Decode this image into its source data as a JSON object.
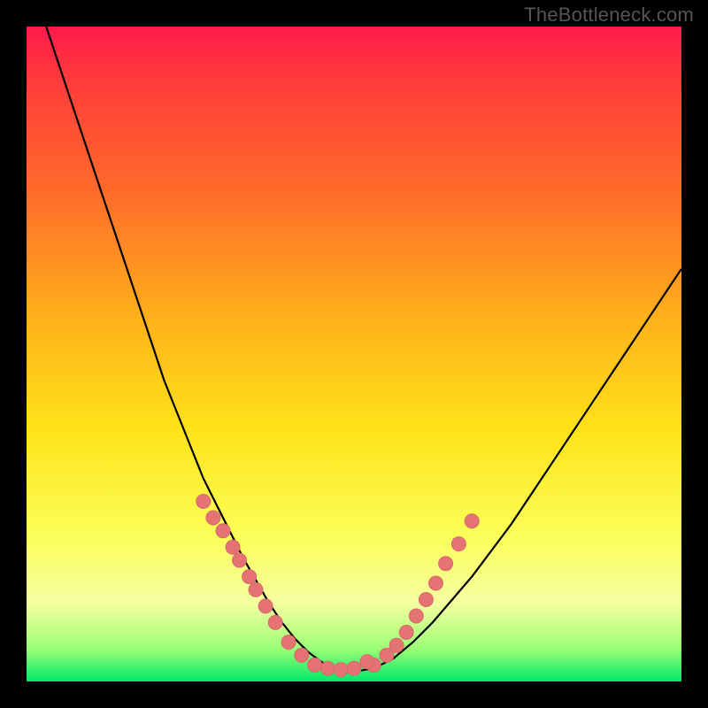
{
  "watermark": "TheBottleneck.com",
  "colors": {
    "curve_stroke": "#000000",
    "marker_fill": "#e57373",
    "marker_stroke": "#d46a6a"
  },
  "chart_data": {
    "type": "line",
    "title": "",
    "xlabel": "",
    "ylabel": "",
    "xlim": [
      0,
      100
    ],
    "ylim": [
      0,
      100
    ],
    "grid": false,
    "series": [
      {
        "name": "bottleneck-curve",
        "x": [
          3,
          5,
          7,
          9,
          11,
          13,
          15,
          17,
          19,
          21,
          23,
          25,
          27,
          29,
          31,
          33,
          35,
          37,
          39,
          41,
          43,
          45,
          47,
          50,
          53,
          56,
          59,
          62,
          65,
          68,
          71,
          74,
          77,
          80,
          83,
          86,
          89,
          92,
          95,
          98,
          100
        ],
        "y": [
          100,
          94,
          88,
          82,
          76,
          70,
          64,
          58,
          52,
          46,
          41,
          36,
          31,
          27,
          23,
          19,
          15.5,
          12,
          9,
          6.5,
          4.5,
          3,
          2,
          1.5,
          2,
          3.5,
          6,
          9,
          12.5,
          16,
          20,
          24,
          28.5,
          33,
          37.5,
          42,
          46.5,
          51,
          55.5,
          60,
          63
        ]
      },
      {
        "name": "left-cluster-markers",
        "type": "scatter",
        "x": [
          27,
          28.5,
          30,
          31.5,
          32.5,
          34,
          35,
          36.5,
          38,
          40
        ],
        "y": [
          27.5,
          25,
          23,
          20.5,
          18.5,
          16,
          14,
          11.5,
          9,
          6
        ]
      },
      {
        "name": "right-cluster-markers",
        "type": "scatter",
        "x": [
          53,
          55,
          56.5,
          58,
          59.5,
          61,
          62.5,
          64,
          66,
          68
        ],
        "y": [
          2.5,
          4,
          5.5,
          7.5,
          10,
          12.5,
          15,
          18,
          21,
          24.5
        ]
      },
      {
        "name": "bottom-cluster-markers",
        "type": "scatter",
        "x": [
          42,
          44,
          46,
          48,
          50,
          52
        ],
        "y": [
          4,
          2.5,
          2,
          1.8,
          2,
          3
        ]
      }
    ]
  }
}
